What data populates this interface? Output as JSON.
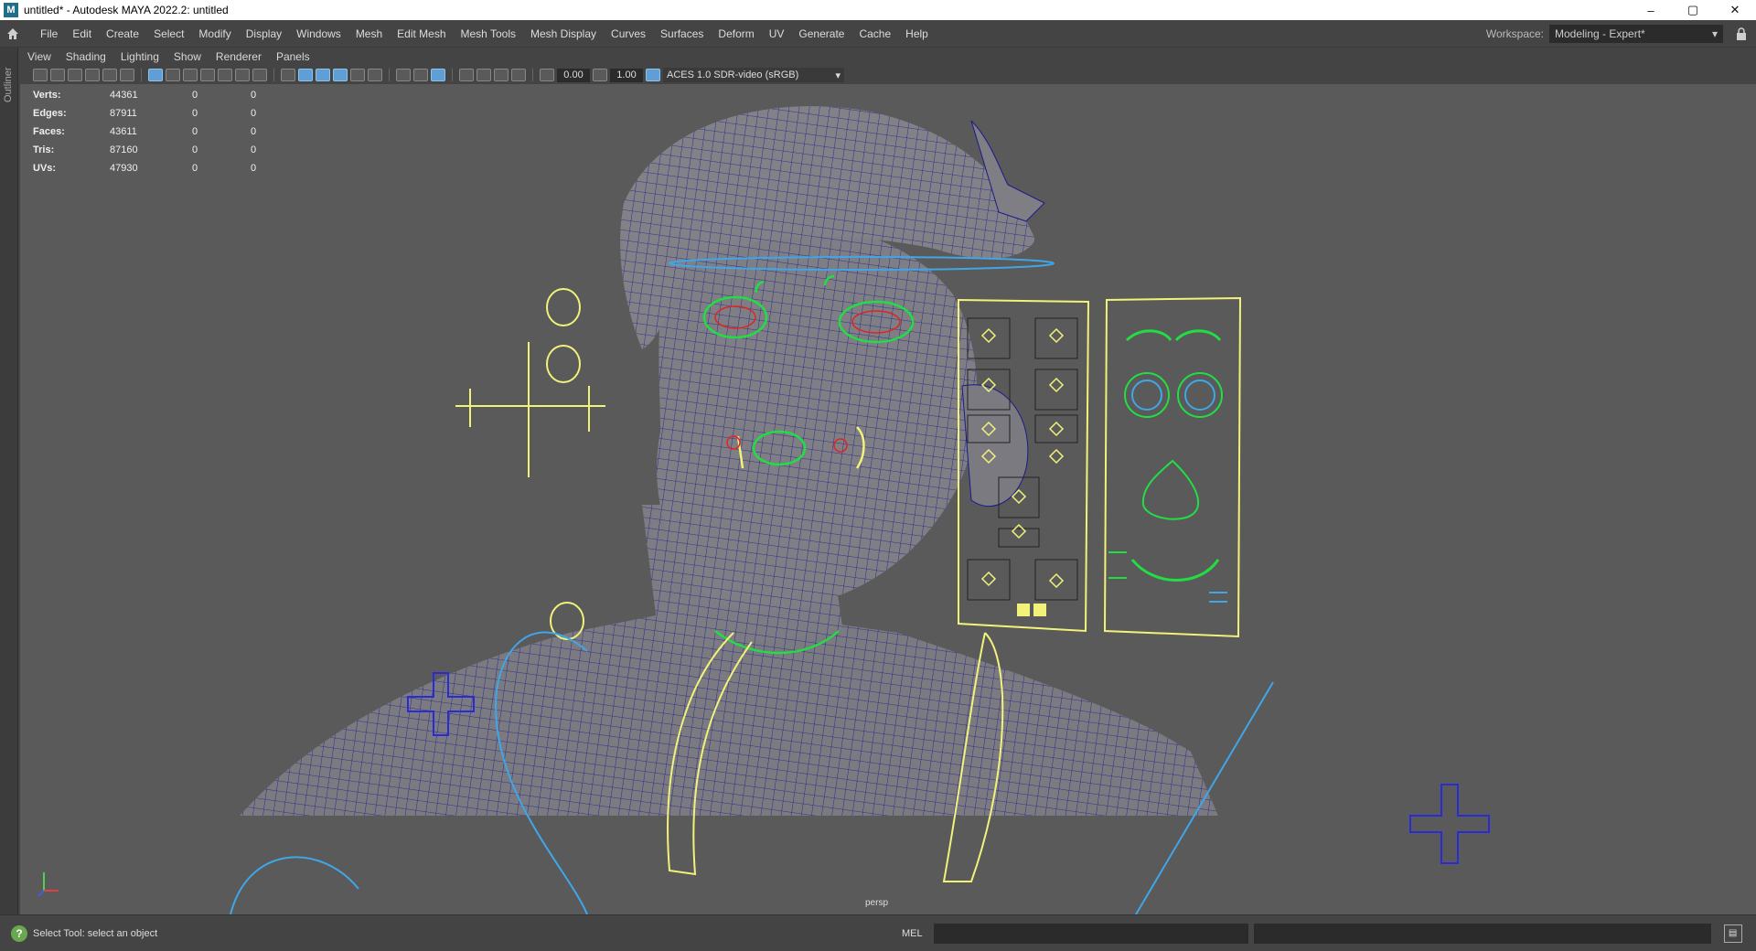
{
  "window": {
    "title": "untitled* - Autodesk MAYA 2022.2: untitled",
    "icon_letter": "M",
    "controls": [
      "–",
      "▢",
      "✕"
    ]
  },
  "menubar": {
    "items": [
      "File",
      "Edit",
      "Create",
      "Select",
      "Modify",
      "Display",
      "Windows",
      "Mesh",
      "Edit Mesh",
      "Mesh Tools",
      "Mesh Display",
      "Curves",
      "Surfaces",
      "Deform",
      "UV",
      "Generate",
      "Cache",
      "Help"
    ],
    "workspace_label": "Workspace:",
    "workspace_value": "Modeling - Expert*"
  },
  "outliner": {
    "label": "Outliner"
  },
  "panel_menu": {
    "items": [
      "View",
      "Shading",
      "Lighting",
      "Show",
      "Renderer",
      "Panels"
    ]
  },
  "panel_toolbar": {
    "exposure": "0.00",
    "gamma": "1.00",
    "color_space": "ACES 1.0 SDR-video (sRGB)"
  },
  "hud": {
    "rows": [
      {
        "label": "Verts:",
        "v1": "44361",
        "v2": "0",
        "v3": "0"
      },
      {
        "label": "Edges:",
        "v1": "87911",
        "v2": "0",
        "v3": "0"
      },
      {
        "label": "Faces:",
        "v1": "43611",
        "v2": "0",
        "v3": "0"
      },
      {
        "label": "Tris:",
        "v1": "87160",
        "v2": "0",
        "v3": "0"
      },
      {
        "label": "UVs:",
        "v1": "47930",
        "v2": "0",
        "v3": "0"
      }
    ]
  },
  "viewport": {
    "camera": "persp",
    "colors": {
      "background": "#5a5a5a",
      "mesh": "#7a7a80",
      "wire": "#1a1a8c",
      "yellow": "#f2f27a",
      "green": "#22dd44",
      "cyan": "#3fa6e8",
      "blue": "#2a2ad8",
      "red": "#e02424"
    }
  },
  "status": {
    "message": "Select Tool: select an object",
    "command_lang": "MEL"
  }
}
